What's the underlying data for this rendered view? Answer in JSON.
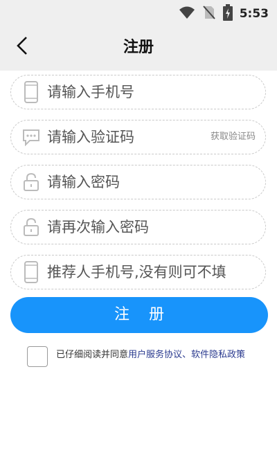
{
  "status_bar": {
    "time": "5:53"
  },
  "nav": {
    "title": "注册"
  },
  "form": {
    "phone": {
      "placeholder": "请输入手机号",
      "value": ""
    },
    "code": {
      "placeholder": "请输入验证码",
      "value": "",
      "get_code_label": "获取验证码"
    },
    "password": {
      "placeholder": "请输入密码",
      "value": ""
    },
    "confirm": {
      "placeholder": "请再次输入密码",
      "value": ""
    },
    "referrer": {
      "placeholder": "推荐人手机号,没有则可不填",
      "value": ""
    }
  },
  "register_button": {
    "label": "注册"
  },
  "agreement": {
    "prefix": "已仔细阅读并同意",
    "service_link": "用户服务协议",
    "separator": "、",
    "privacy_link": "软件隐私政策"
  },
  "colors": {
    "primary": "#1894fb",
    "link": "#2a3a8f",
    "header_bg": "#efefef"
  }
}
